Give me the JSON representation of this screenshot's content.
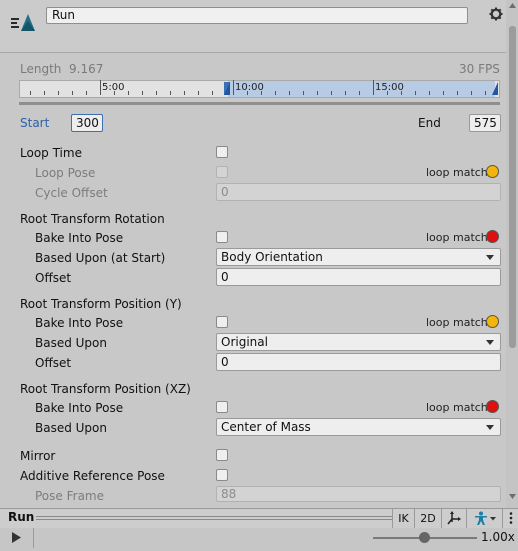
{
  "header": {
    "clip_name": "Run"
  },
  "timeline": {
    "length_label": "Length",
    "length_value": "9.167",
    "fps": "30 FPS",
    "ticks": [
      "5:00",
      "10:00",
      "15:00"
    ],
    "start_label": "Start",
    "start_value": "300",
    "end_label": "End",
    "end_value": "575"
  },
  "loop": {
    "loop_time": "Loop Time",
    "loop_pose": "Loop Pose",
    "cycle_offset": "Cycle Offset",
    "cycle_offset_value": "0",
    "loop_match": "loop match",
    "loop_match_color": "#f2b50c"
  },
  "root_rotation": {
    "title": "Root Transform Rotation",
    "bake": "Bake Into Pose",
    "based_upon": "Based Upon (at Start)",
    "based_upon_value": "Body Orientation",
    "offset": "Offset",
    "offset_value": "0",
    "loop_match": "loop match",
    "loop_match_color": "#e11010"
  },
  "root_pos_y": {
    "title": "Root Transform Position (Y)",
    "bake": "Bake Into Pose",
    "based_upon": "Based Upon",
    "based_upon_value": "Original",
    "offset": "Offset",
    "offset_value": "0",
    "loop_match": "loop match",
    "loop_match_color": "#f2b50c"
  },
  "root_pos_xz": {
    "title": "Root Transform Position (XZ)",
    "bake": "Bake Into Pose",
    "based_upon": "Based Upon",
    "based_upon_value": "Center of Mass",
    "loop_match": "loop match",
    "loop_match_color": "#e11010"
  },
  "misc": {
    "mirror": "Mirror",
    "additive": "Additive Reference Pose",
    "pose_frame": "Pose Frame",
    "pose_frame_value": "88"
  },
  "preview": {
    "title": "Run",
    "ik": "IK",
    "two_d": "2D",
    "pivot_icon": "pivot-icon",
    "avatar_icon": "avatar-icon",
    "menu_icon": "kebab-menu-icon",
    "speed": "1.00x"
  }
}
